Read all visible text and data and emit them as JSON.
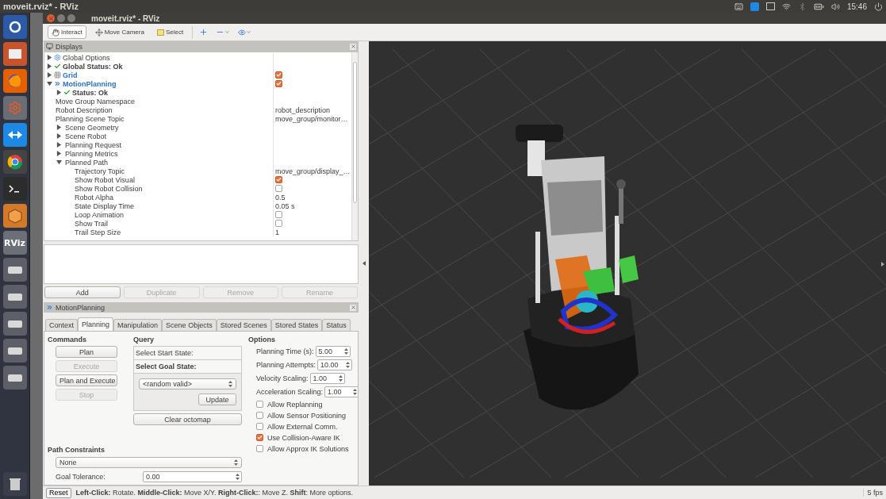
{
  "os_top_bar": {
    "title": "moveit.rviz* - RViz",
    "clock": "15:46"
  },
  "launcher": {
    "rviz_label": "RViz"
  },
  "window": {
    "title": "moveit.rviz* - RViz"
  },
  "toolbar": {
    "tools": [
      {
        "label": "Interact",
        "selected": true
      },
      {
        "label": "Move Camera",
        "selected": false
      },
      {
        "label": "Select",
        "selected": false
      }
    ]
  },
  "displays_panel": {
    "title": "Displays",
    "tree": [
      {
        "kind": "global_options",
        "label": "Global Options",
        "expanded": false
      },
      {
        "kind": "status",
        "label": "Global Status: Ok",
        "expanded": false
      },
      {
        "kind": "grid_display",
        "label": "Grid",
        "expanded": false,
        "checked": true
      },
      {
        "kind": "planning_display",
        "label": "MotionPlanning",
        "expanded": true,
        "checked": true,
        "children": [
          {
            "kind": "status",
            "label": "Status: Ok",
            "expanded": false
          },
          {
            "kind": "property",
            "label": "Move Group Namespace"
          },
          {
            "kind": "property",
            "label": "Robot Description",
            "value": "robot_description"
          },
          {
            "kind": "property",
            "label": "Planning Scene Topic",
            "value": "move_group/monitor…"
          },
          {
            "kind": "property",
            "label": "Scene Geometry",
            "expanded": false
          },
          {
            "kind": "property",
            "label": "Scene Robot",
            "expanded": false
          },
          {
            "kind": "property",
            "label": "Planning Request",
            "expanded": false
          },
          {
            "kind": "property",
            "label": "Planning Metrics",
            "expanded": false
          },
          {
            "kind": "property",
            "label": "Planned Path",
            "expanded": true,
            "children": [
              {
                "kind": "property",
                "label": "Trajectory Topic",
                "value": "move_group/display_…"
              },
              {
                "kind": "property",
                "label": "Show Robot Visual",
                "checked": true
              },
              {
                "kind": "property",
                "label": "Show Robot Collision",
                "checked": false
              },
              {
                "kind": "property",
                "label": "Robot Alpha",
                "value": "0.5"
              },
              {
                "kind": "property",
                "label": "State Display Time",
                "value": "0.05 s"
              },
              {
                "kind": "property",
                "label": "Loop Animation",
                "checked": false
              },
              {
                "kind": "property",
                "label": "Show Trail",
                "checked": false
              },
              {
                "kind": "property",
                "label": "Trail Step Size",
                "value": "1"
              }
            ]
          }
        ]
      }
    ],
    "buttons": [
      {
        "label": "Add",
        "disabled": false
      },
      {
        "label": "Duplicate",
        "disabled": true
      },
      {
        "label": "Remove",
        "disabled": true
      },
      {
        "label": "Rename",
        "disabled": true
      }
    ]
  },
  "motion_planning_panel": {
    "title": "MotionPlanning",
    "tabs": [
      {
        "label": "Context",
        "selected": false
      },
      {
        "label": "Planning",
        "selected": true
      },
      {
        "label": "Manipulation",
        "selected": false
      },
      {
        "label": "Scene Objects",
        "selected": false
      },
      {
        "label": "Stored Scenes",
        "selected": false
      },
      {
        "label": "Stored States",
        "selected": false
      },
      {
        "label": "Status",
        "selected": false
      }
    ],
    "commands": {
      "title": "Commands",
      "buttons": [
        {
          "label": "Plan",
          "disabled": false
        },
        {
          "label": "Execute",
          "disabled": true
        },
        {
          "label": "Plan and Execute",
          "disabled": false
        },
        {
          "label": "Stop",
          "disabled": true
        }
      ]
    },
    "query": {
      "title": "Query",
      "start_state": "Select Start State:",
      "goal_state": "Select Goal State:",
      "goal_select": "<random valid>",
      "update": "Update",
      "clear_octomap": "Clear octomap"
    },
    "options": {
      "title": "Options",
      "spinboxes": [
        {
          "label": "Planning Time (s):",
          "value": "5.00"
        },
        {
          "label": "Planning Attempts:",
          "value": "10.00"
        },
        {
          "label": "Velocity Scaling:",
          "value": "1.00"
        },
        {
          "label": "Acceleration Scaling:",
          "value": "1.00"
        }
      ],
      "checkboxes": [
        {
          "label": "Allow Replanning",
          "checked": false
        },
        {
          "label": "Allow Sensor Positioning",
          "checked": false
        },
        {
          "label": "Allow External Comm.",
          "checked": false
        },
        {
          "label": "Use Collision-Aware IK",
          "checked": true
        },
        {
          "label": "Allow Approx IK Solutions",
          "checked": false
        }
      ]
    },
    "path_constraints": {
      "title": "Path Constraints",
      "value": "None"
    },
    "goal_tolerance": {
      "label": "Goal Tolerance:",
      "value": "0.00"
    }
  },
  "status_bar": {
    "reset": "Reset",
    "hint": "**Left-Click:** Rotate. **Middle-Click:** Move X/Y. **Right-Click:**: Move Z. **Shift**: More options.",
    "fps": "5 fps"
  }
}
